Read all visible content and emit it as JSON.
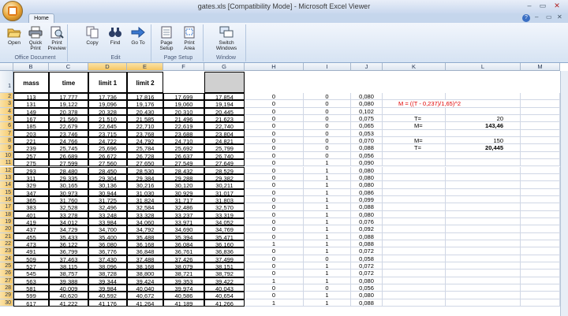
{
  "window": {
    "title": "gates.xls  [Compatibility Mode] - Microsoft Excel Viewer",
    "controls": [
      "–",
      "▭",
      "✕"
    ]
  },
  "tabs": {
    "home": "Home"
  },
  "ribbon": {
    "groups": [
      {
        "label": "Office Document",
        "buttons": [
          {
            "label": "Open",
            "icon": "folder-open-icon"
          },
          {
            "label": "Quick Print",
            "icon": "printer-icon"
          },
          {
            "label": "Print Preview",
            "icon": "print-preview-icon"
          }
        ]
      },
      {
        "label": "Edit",
        "buttons": [
          {
            "label": "Copy",
            "icon": "copy-icon"
          },
          {
            "label": "Find",
            "icon": "binoculars-icon"
          },
          {
            "label": "Go To",
            "icon": "arrow-right-icon"
          }
        ]
      },
      {
        "label": "Page Setup",
        "buttons": [
          {
            "label": "Page Setup",
            "icon": "page-setup-icon"
          },
          {
            "label": "Print Area",
            "icon": "print-area-icon"
          }
        ]
      },
      {
        "label": "Window",
        "buttons": [
          {
            "label": "Switch Windows",
            "icon": "switch-windows-icon"
          }
        ]
      }
    ]
  },
  "sheet": {
    "columns": [
      "B",
      "C",
      "D",
      "E",
      "F",
      "G",
      "H",
      "I",
      "J",
      "K",
      "L",
      "M"
    ],
    "selected_columns": [
      "D",
      "E"
    ],
    "header_labels": [
      "mass",
      "time",
      "limit 1",
      "limit 2"
    ],
    "rows": [
      [
        "113",
        "17,777",
        "17,736",
        "17,816",
        "17,699",
        "17,854",
        "0",
        "0",
        "0,080"
      ],
      [
        "131",
        "19,122",
        "19,096",
        "19,176",
        "19,060",
        "19,194",
        "0",
        "0",
        "0,080"
      ],
      [
        "149",
        "20,378",
        "20,328",
        "20,430",
        "20,310",
        "20,445",
        "0",
        "0",
        "0,102"
      ],
      [
        "167",
        "21,560",
        "21,510",
        "21,585",
        "21,496",
        "21,623",
        "0",
        "0",
        "0,075"
      ],
      [
        "185",
        "22,679",
        "22,645",
        "22,710",
        "22,619",
        "22,740",
        "0",
        "0",
        "0,065"
      ],
      [
        "203",
        "23,746",
        "23,715",
        "23,768",
        "23,688",
        "23,804",
        "0",
        "0",
        "0,053"
      ],
      [
        "221",
        "24,766",
        "24,722",
        "24,792",
        "24,710",
        "24,821",
        "0",
        "0",
        "0,070"
      ],
      [
        "239",
        "25,745",
        "25,696",
        "25,784",
        "25,692",
        "25,799",
        "0",
        "0",
        "0,088"
      ],
      [
        "257",
        "26,689",
        "26,672",
        "26,728",
        "26,637",
        "26,740",
        "0",
        "0",
        "0,056"
      ],
      [
        "275",
        "27,599",
        "27,560",
        "27,650",
        "27,549",
        "27,649",
        "0",
        "1",
        "0,090"
      ],
      [
        "293",
        "28,480",
        "28,450",
        "28,530",
        "28,432",
        "28,529",
        "0",
        "1",
        "0,080"
      ],
      [
        "311",
        "29,335",
        "29,304",
        "29,384",
        "29,288",
        "29,382",
        "0",
        "1",
        "0,080"
      ],
      [
        "329",
        "30,165",
        "30,136",
        "30,216",
        "30,120",
        "30,211",
        "0",
        "1",
        "0,080"
      ],
      [
        "347",
        "30,973",
        "30,944",
        "31,030",
        "30,929",
        "31,017",
        "0",
        "1",
        "0,086"
      ],
      [
        "365",
        "31,760",
        "31,725",
        "31,824",
        "31,717",
        "31,803",
        "0",
        "1",
        "0,099"
      ],
      [
        "383",
        "32,528",
        "32,496",
        "32,584",
        "32,486",
        "32,570",
        "0",
        "1",
        "0,088"
      ],
      [
        "401",
        "33,278",
        "33,248",
        "33,328",
        "33,237",
        "33,319",
        "0",
        "1",
        "0,080"
      ],
      [
        "419",
        "34,012",
        "33,984",
        "34,060",
        "33,971",
        "34,052",
        "0",
        "1",
        "0,076"
      ],
      [
        "437",
        "34,729",
        "34,700",
        "34,792",
        "34,690",
        "34,769",
        "0",
        "1",
        "0,092"
      ],
      [
        "455",
        "35,433",
        "35,400",
        "35,488",
        "35,394",
        "35,471",
        "0",
        "1",
        "0,088"
      ],
      [
        "473",
        "36,122",
        "36,080",
        "36,168",
        "36,084",
        "36,160",
        "1",
        "1",
        "0,088"
      ],
      [
        "491",
        "36,799",
        "36,776",
        "36,848",
        "36,761",
        "36,836",
        "0",
        "1",
        "0,072"
      ],
      [
        "509",
        "37,463",
        "37,430",
        "37,488",
        "37,426",
        "37,499",
        "0",
        "0",
        "0,058"
      ],
      [
        "527",
        "38,115",
        "38,096",
        "38,168",
        "38,079",
        "38,151",
        "0",
        "1",
        "0,072"
      ],
      [
        "545",
        "38,757",
        "38,728",
        "38,800",
        "38,721",
        "38,792",
        "0",
        "1",
        "0,072"
      ],
      [
        "563",
        "39,388",
        "39,344",
        "39,424",
        "39,353",
        "39,422",
        "1",
        "1",
        "0,080"
      ],
      [
        "581",
        "40,009",
        "39,984",
        "40,040",
        "39,974",
        "40,043",
        "0",
        "0",
        "0,056"
      ],
      [
        "599",
        "40,620",
        "40,592",
        "40,672",
        "40,586",
        "40,654",
        "0",
        "1",
        "0,080"
      ],
      [
        "617",
        "41,222",
        "41,176",
        "41,264",
        "41,189",
        "41,266",
        "1",
        "1",
        "0,088"
      ]
    ],
    "formula_note": "M = ((T - 0,237)/1,65)^2",
    "side_calc": [
      {
        "label": "T=",
        "value": "20"
      },
      {
        "label": "M=",
        "value": "143,46"
      },
      {
        "label": "M=",
        "value": "150"
      },
      {
        "label": "T=",
        "value": "20,445"
      }
    ]
  }
}
